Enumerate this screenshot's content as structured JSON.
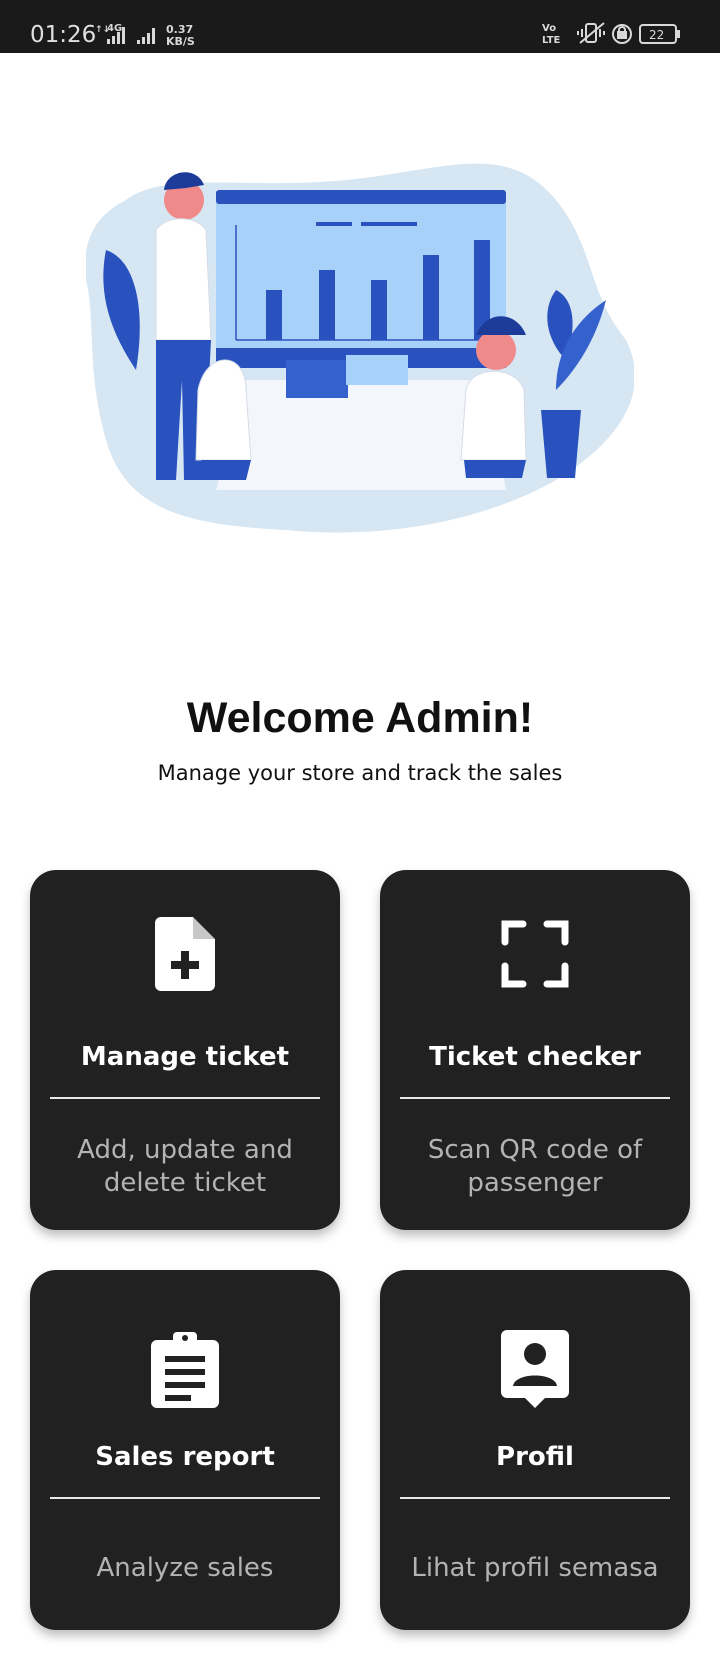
{
  "status_bar": {
    "time": "01:26",
    "network_label": "4G",
    "speed_value": "0.37",
    "speed_unit": "KB/S",
    "volte_label": "Vo LTE",
    "battery": "22"
  },
  "illustration": {
    "icon": "business-meeting-illustration"
  },
  "welcome": {
    "title": "Welcome Admin!",
    "subtitle": "Manage your store and track the sales"
  },
  "menu": [
    {
      "title": "Manage ticket",
      "description": "Add, update and delete ticket",
      "icon": "add-document-icon"
    },
    {
      "title": "Ticket checker",
      "description": "Scan QR code of passenger",
      "icon": "scan-frame-icon"
    },
    {
      "title": "Sales report",
      "description": "Analyze sales",
      "icon": "clipboard-icon"
    },
    {
      "title": "Profil",
      "description": "Lihat profil semasa",
      "icon": "profile-badge-icon"
    }
  ],
  "colors": {
    "card_bg": "#212121",
    "status_bar_bg": "#1a1a1a",
    "accent_blue": "#2a52be",
    "light_blue": "#8cc0f5"
  }
}
